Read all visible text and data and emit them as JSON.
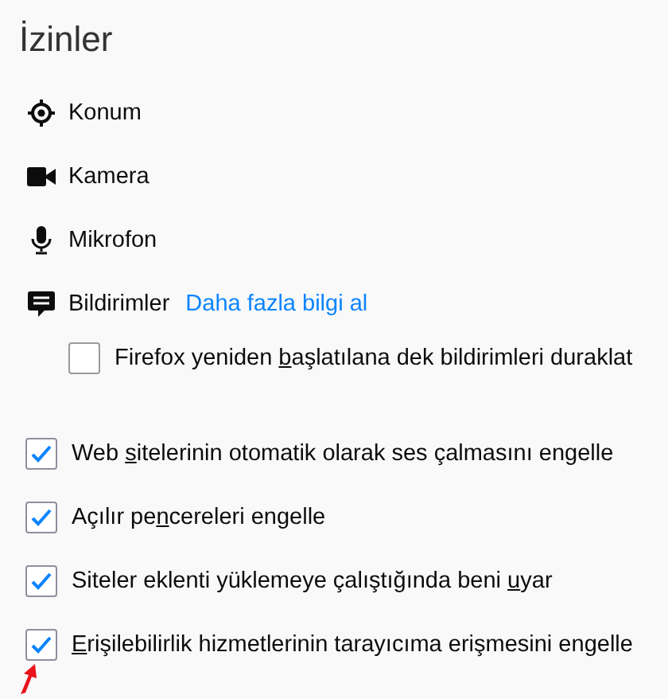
{
  "title": "İzinler",
  "permissions": [
    {
      "kind": "location",
      "label": "Konum"
    },
    {
      "kind": "camera",
      "label": "Kamera"
    },
    {
      "kind": "microphone",
      "label": "Mikrofon"
    },
    {
      "kind": "notifications",
      "label": "Bildirimler",
      "link": "Daha fazla bilgi al"
    }
  ],
  "notification_pause": {
    "text_before": "Firefox yeniden ",
    "accesskey": "b",
    "text_after": "aşlatılana dek bildirimleri duraklat",
    "checked": false
  },
  "options": [
    {
      "text_before": "Web ",
      "accesskey": "s",
      "text_after": "itelerinin otomatik olarak ses çalmasını engelle",
      "checked": true
    },
    {
      "text_before": "Açılır pe",
      "accesskey": "n",
      "text_after": "cereleri engelle",
      "checked": true
    },
    {
      "text_before": "Siteler eklenti yüklemeye çalıştığında beni ",
      "accesskey": "u",
      "text_after": "yar",
      "checked": true
    },
    {
      "accesskey": "E",
      "text_after": "rişilebilirlik hizmetlerinin tarayıcıma erişmesini engelle",
      "checked": true
    }
  ]
}
